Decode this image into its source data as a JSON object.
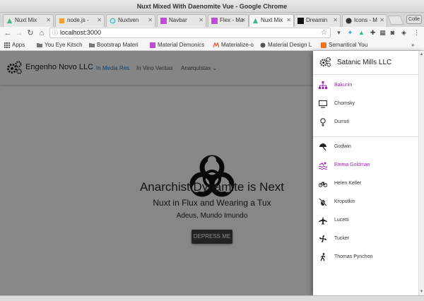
{
  "window": {
    "title": "Nuxt Mixed With Daenomite Vue - Google Chrome"
  },
  "tabs": [
    {
      "label": "Nuxt Mix",
      "icon": "nuxt-icon",
      "color": "#41b883"
    },
    {
      "label": "node.js -",
      "icon": "code-icon",
      "color": "#f0a030"
    },
    {
      "label": "Nuxtven",
      "icon": "spinner-icon",
      "color": "#52b5c8"
    },
    {
      "label": "Navbar",
      "icon": "materialize-icon",
      "color": "#c04bd6"
    },
    {
      "label": "Flex - Ma",
      "icon": "materialize-icon",
      "color": "#c04bd6"
    },
    {
      "label": "Nuxt Mix",
      "icon": "nuxt-icon",
      "color": "#41b883"
    },
    {
      "label": "Dreamin",
      "icon": "medium-icon",
      "color": "#111111"
    },
    {
      "label": "Icons - M",
      "icon": "github-icon",
      "color": "#333333"
    }
  ],
  "profile_label": "Colle",
  "address": {
    "url": "localhost:3000"
  },
  "bookmarks": [
    {
      "label": "Apps",
      "icon": "apps-grid-icon"
    },
    {
      "label": "You Eye Kitsch",
      "icon": "folder-icon"
    },
    {
      "label": "Bootstrap Materi",
      "icon": "folder-icon"
    },
    {
      "label": "Material Demonics",
      "icon": "materialize-icon"
    },
    {
      "label": "Materialize-o",
      "icon": "m-logo-icon"
    },
    {
      "label": "Material Design L",
      "icon": "circle-logo-icon"
    },
    {
      "label": "Semantical You",
      "icon": "semantic-icon"
    }
  ],
  "appbar": {
    "brand": "Engenho Novo LLC",
    "links": [
      "In Media Res",
      "In Vino Veritas",
      "Anarquistas"
    ]
  },
  "hero": {
    "title": "Anarchist Dynamite is Next",
    "subtitle": "Nuxt in Flux and Wearing a Tux",
    "tagline": "Adeus, Mundo Imundo",
    "button": "DEPRESS ME"
  },
  "drawer": {
    "title": "Satanic Mills LLC",
    "group1": [
      {
        "label": "Bakunin",
        "icon": "hierarchy-icon",
        "active": true
      },
      {
        "label": "Chomsky",
        "icon": "monitor-icon",
        "active": false
      },
      {
        "label": "Durruti",
        "icon": "female-symbol-icon",
        "active": false
      }
    ],
    "group2": [
      {
        "label": "Godwin",
        "icon": "umbrella-icon",
        "active": false
      },
      {
        "label": "Emma Goldman",
        "icon": "swimmer-icon",
        "active": true
      },
      {
        "label": "Helen Keller",
        "icon": "bicycle-icon",
        "active": false
      },
      {
        "label": "Kropotkin",
        "icon": "no-bug-icon",
        "active": false
      },
      {
        "label": "Lucetti",
        "icon": "airplane-icon",
        "active": false
      },
      {
        "label": "Tucker",
        "icon": "fan-icon",
        "active": false
      },
      {
        "label": "Thomas Pynchon",
        "icon": "walker-icon",
        "active": false
      }
    ]
  },
  "colors": {
    "accent": "#9c27b0",
    "link": "#1976d2",
    "button": "#424242"
  }
}
